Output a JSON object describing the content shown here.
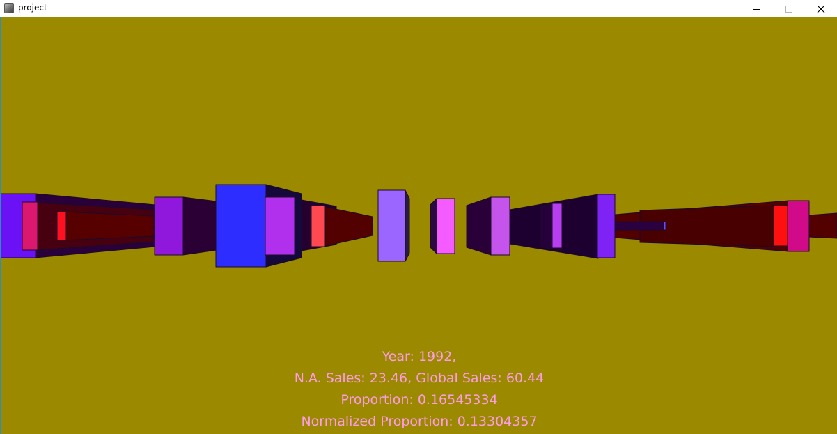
{
  "window": {
    "title": "project",
    "icon": "app-window-icon",
    "controls": [
      "minimize-icon",
      "maximize-icon",
      "close-icon"
    ]
  },
  "colors": {
    "background": "#9b8a00",
    "info_text": "#ff9ce8"
  },
  "info": {
    "year_line": "Year: 1992,",
    "sales_line": "N.A. Sales: 23.46, Global Sales: 60.44",
    "proportion_line": "Proportion: 0.16545334",
    "normalized_line": "Normalized Proportion: 0.13304357"
  }
}
